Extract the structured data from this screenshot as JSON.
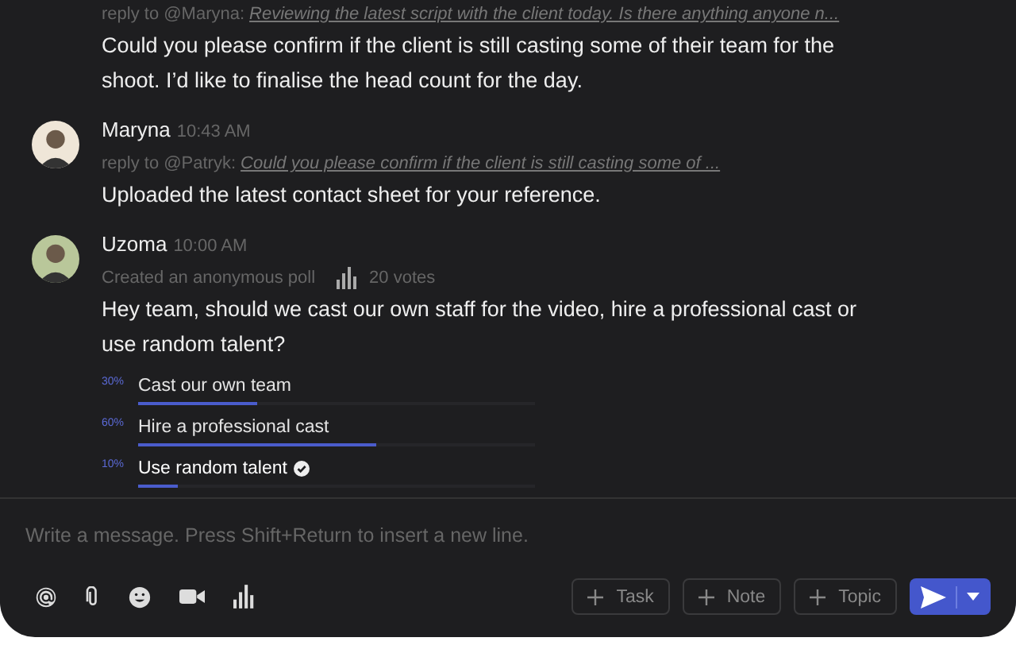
{
  "messages": [
    {
      "reply_prefix": "reply to @Maryna:",
      "reply_quote": "Reviewing the latest script with the client today. Is there anything anyone n...",
      "body": "Could you please confirm if the client is still casting some of their team for the shoot. I’d like to finalise the head count for the day."
    },
    {
      "author": "Maryna",
      "time": "10:43 AM",
      "reply_prefix": "reply to @Patryk:",
      "reply_quote": "Could you please confirm if the client is still casting some of ...",
      "body": "Uploaded the latest contact sheet for your reference."
    },
    {
      "author": "Uzoma",
      "time": "10:00 AM",
      "poll": {
        "caption": "Created an anonymous poll",
        "votes": "20 votes",
        "options": [
          {
            "percent": "30%",
            "label": "Cast our own team",
            "level": 0.3,
            "selected": false
          },
          {
            "percent": "60%",
            "label": "Hire a professional cast",
            "level": 0.6,
            "selected": false
          },
          {
            "percent": "10%",
            "label": "Use random talent",
            "level": 0.1,
            "selected": true
          }
        ]
      },
      "body": "Hey team, should we cast our own staff for the video, hire a professional cast or use random talent?"
    }
  ],
  "composer": {
    "placeholder": "Write a message. Press Shift+Return to insert a new line.",
    "actions": [
      "Task",
      "Note",
      "Topic"
    ]
  }
}
